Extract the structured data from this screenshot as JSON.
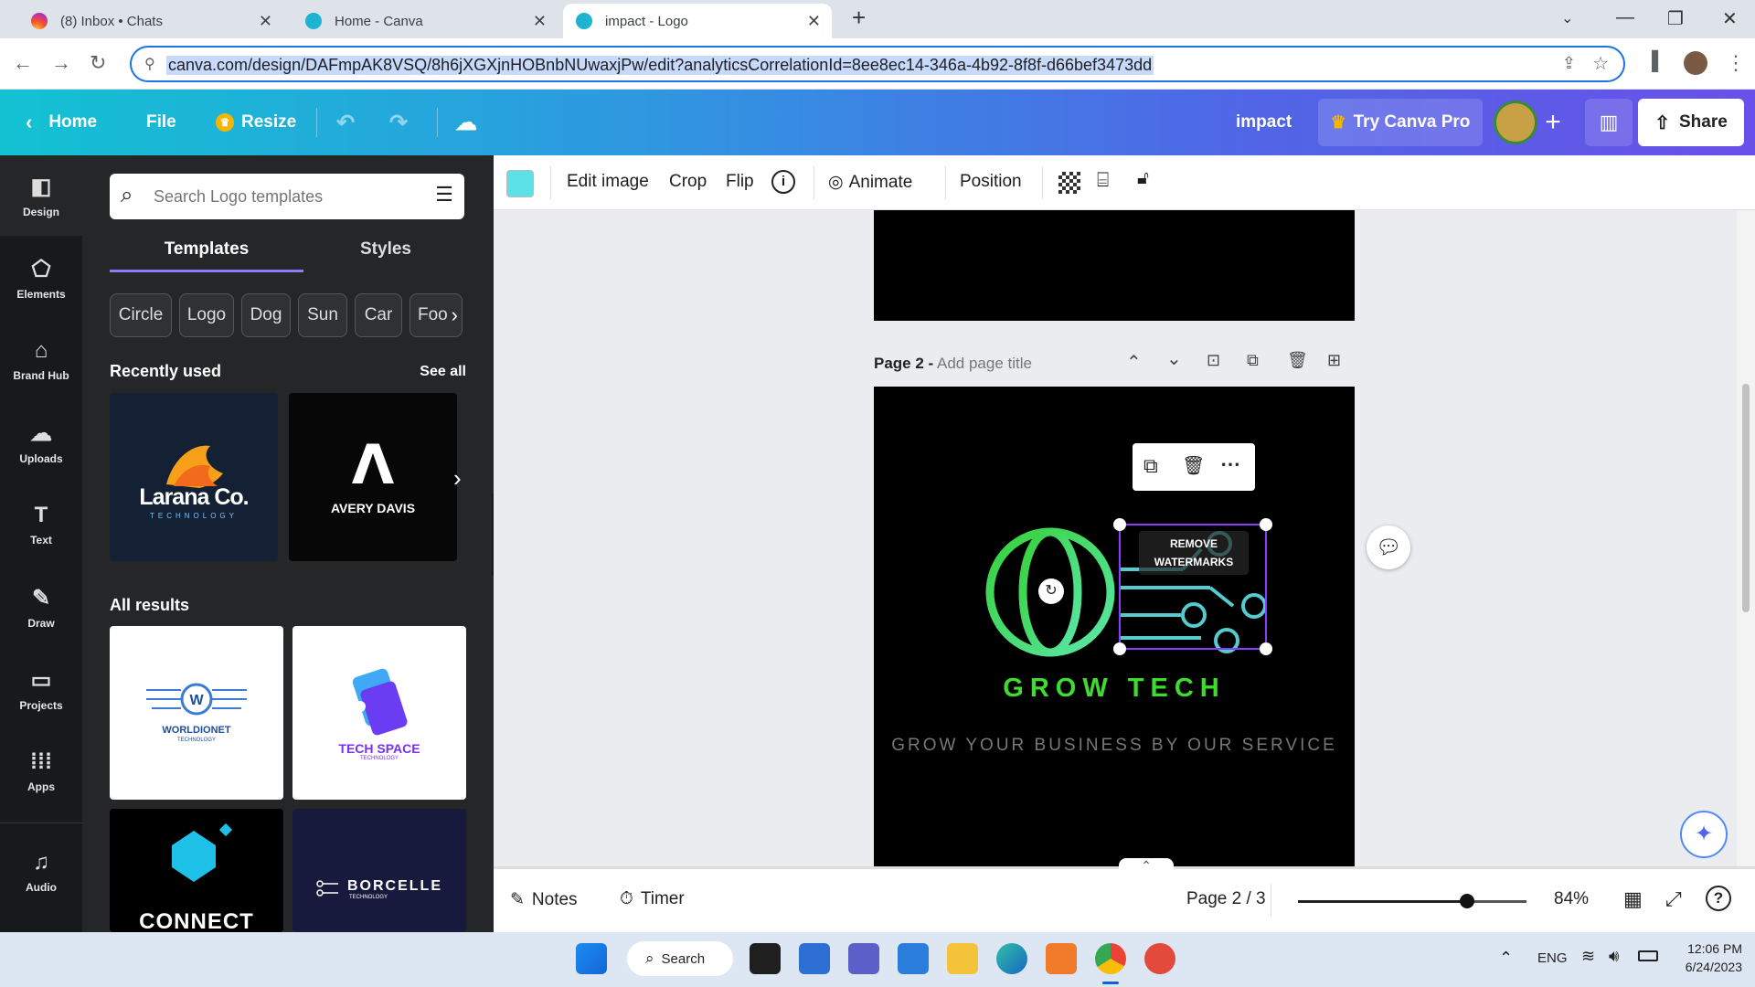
{
  "browser": {
    "tabs": [
      {
        "title": "(8) Inbox • Chats"
      },
      {
        "title": "Home - Canva"
      },
      {
        "title": "impact - Logo"
      }
    ],
    "url": "canva.com/design/DAFmpAK8VSQ/8h6jXGXjnHOBnbNUwaxjPw/edit?analyticsCorrelationId=8ee8ec14-346a-4b92-8f8f-d66bef3473dd"
  },
  "header": {
    "home": "Home",
    "file": "File",
    "resize": "Resize",
    "doc_title": "impact",
    "try_pro": "Try Canva Pro",
    "share": "Share"
  },
  "rail": {
    "items": [
      {
        "label": "Design",
        "icon": "design-icon"
      },
      {
        "label": "Elements",
        "icon": "elements-icon"
      },
      {
        "label": "Brand Hub",
        "icon": "brand-hub-icon"
      },
      {
        "label": "Uploads",
        "icon": "uploads-icon"
      },
      {
        "label": "Text",
        "icon": "text-icon"
      },
      {
        "label": "Draw",
        "icon": "draw-icon"
      },
      {
        "label": "Projects",
        "icon": "projects-icon"
      },
      {
        "label": "Apps",
        "icon": "apps-icon"
      },
      {
        "label": "Audio",
        "icon": "audio-icon"
      }
    ]
  },
  "panel": {
    "search_placeholder": "Search Logo templates",
    "tabs": [
      "Templates",
      "Styles"
    ],
    "chips": [
      "Circle",
      "Logo",
      "Dog",
      "Sun",
      "Car",
      "Foo"
    ],
    "recently_used": "Recently used",
    "see_all": "See all",
    "recent": [
      {
        "name": "Larana Co.",
        "sub": "TECHNOLOGY"
      },
      {
        "name": "AVERY DAVIS"
      }
    ],
    "all_results": "All results",
    "results": [
      {
        "name": "WORLDIONET",
        "sub": "TECHNOLOGY"
      },
      {
        "name": "TECH SPACE",
        "sub": "TECHNOLOGY"
      },
      {
        "name": "CONNECT"
      },
      {
        "name": "BORCELLE",
        "sub": "TECHNOLOGY"
      }
    ]
  },
  "toolbar": {
    "edit_image": "Edit image",
    "crop": "Crop",
    "flip": "Flip",
    "animate": "Animate",
    "position": "Position",
    "swatch_color": "#5ce1e6"
  },
  "page": {
    "label": "Page 2 -",
    "title_placeholder": "Add page title",
    "watermark": "REMOVE WATERMARKS",
    "brand": "GROW TECH",
    "tagline": "GROW YOUR BUSINESS BY OUR SERVICE",
    "brand_color": "#3ddc2e"
  },
  "bottom": {
    "notes": "Notes",
    "timer": "Timer",
    "page_indicator": "Page 2 / 3",
    "zoom": "84%",
    "zoom_level": 0.74
  },
  "taskbar": {
    "search": "Search",
    "lang": "ENG",
    "time": "12:06 PM",
    "date": "6/24/2023"
  }
}
